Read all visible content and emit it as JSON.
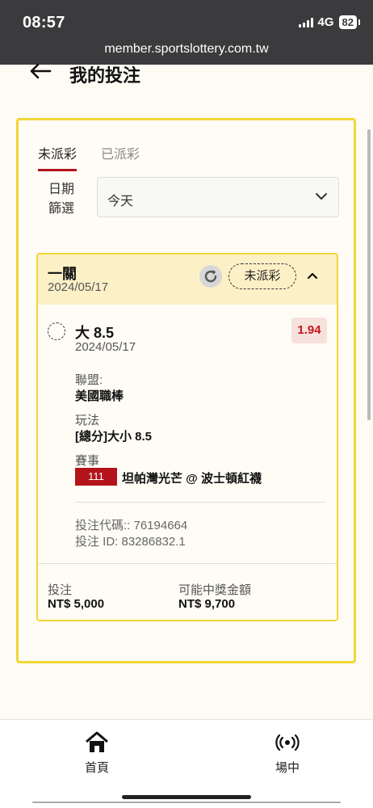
{
  "status_bar": {
    "time": "08:57",
    "network": "4G",
    "battery": "82"
  },
  "browser": {
    "url": "member.sportslottery.com.tw"
  },
  "header": {
    "title": "我的投注"
  },
  "tabs": [
    {
      "label": "未派彩",
      "active": true
    },
    {
      "label": "已派彩",
      "active": false
    }
  ],
  "filter": {
    "label": "日期\n篩選",
    "selected": "今天"
  },
  "bet": {
    "title": "一關",
    "date": "2024/05/17",
    "status": "未派彩",
    "selection": "大 8.5",
    "odds": "1.94",
    "selection_date": "2024/05/17",
    "league_label": "聯盟:",
    "league_value": "美國職棒",
    "market_label": "玩法",
    "market_value": "[總分]大小 8.5",
    "event_label": "賽事",
    "event_number": "111",
    "event_name": "坦帕灣光芒 @ 波士頓紅襪",
    "bet_code": "投注代碼:: 76194664",
    "bet_id": "投注 ID: 83286832.1",
    "stake_label": "投注",
    "stake_value": "NT$ 5,000",
    "payout_label": "可能中獎金額",
    "payout_value": "NT$ 9,700"
  },
  "bottom_nav": [
    {
      "label": "首頁",
      "icon": "home-icon"
    },
    {
      "label": "場中",
      "icon": "live-icon"
    }
  ],
  "colors": {
    "accent": "#b3141b",
    "panel_border": "#f1d636",
    "card_header": "#fcf0c7",
    "odds": "#c3171e"
  }
}
